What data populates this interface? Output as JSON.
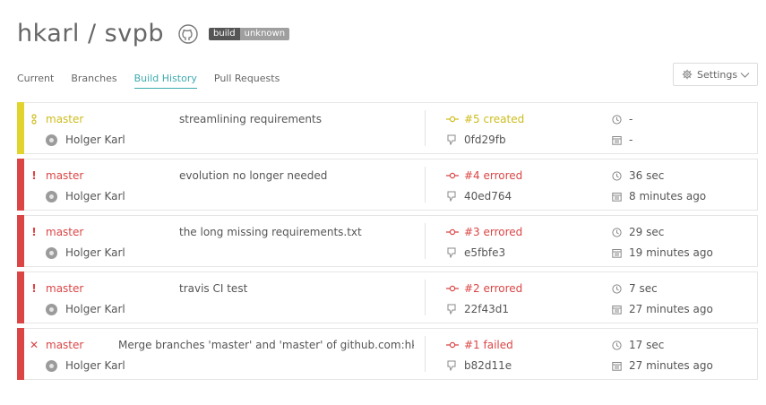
{
  "repo": {
    "title": "hkarl / svpb",
    "badge_left": "build",
    "badge_right": "unknown"
  },
  "tabs": [
    {
      "label": "Current"
    },
    {
      "label": "Branches"
    },
    {
      "label": "Build History"
    },
    {
      "label": "Pull Requests"
    }
  ],
  "settings": {
    "label": "Settings"
  },
  "colors": {
    "created": "#e1d42f",
    "errored": "#db4545",
    "failed": "#db4545",
    "accent": "#3eaaaf"
  },
  "builds": [
    {
      "status": "created",
      "status_icon": "o",
      "branch": "master",
      "author": "Holger Karl",
      "message": "streamlining requirements",
      "state": "#5 created",
      "commit": "0fd29fb",
      "duration": "-",
      "finished": "-"
    },
    {
      "status": "errored",
      "status_icon": "!",
      "branch": "master",
      "author": "Holger Karl",
      "message": "evolution no longer needed",
      "state": "#4 errored",
      "commit": "40ed764",
      "duration": "36 sec",
      "finished": "8 minutes ago"
    },
    {
      "status": "errored",
      "status_icon": "!",
      "branch": "master",
      "author": "Holger Karl",
      "message": "the long missing requirements.txt",
      "state": "#3 errored",
      "commit": "e5fbfe3",
      "duration": "29 sec",
      "finished": "19 minutes ago"
    },
    {
      "status": "errored",
      "status_icon": "!",
      "branch": "master",
      "author": "Holger Karl",
      "message": "travis CI test",
      "state": "#2 errored",
      "commit": "22f43d1",
      "duration": "7 sec",
      "finished": "27 minutes ago"
    },
    {
      "status": "failed",
      "status_icon": "✕",
      "branch": "master",
      "author": "Holger Karl",
      "message": "Merge branches 'master' and 'master' of github.com:hkarl/svpb",
      "state": "#1 failed",
      "commit": "b82d11e",
      "duration": "17 sec",
      "finished": "27 minutes ago"
    }
  ]
}
